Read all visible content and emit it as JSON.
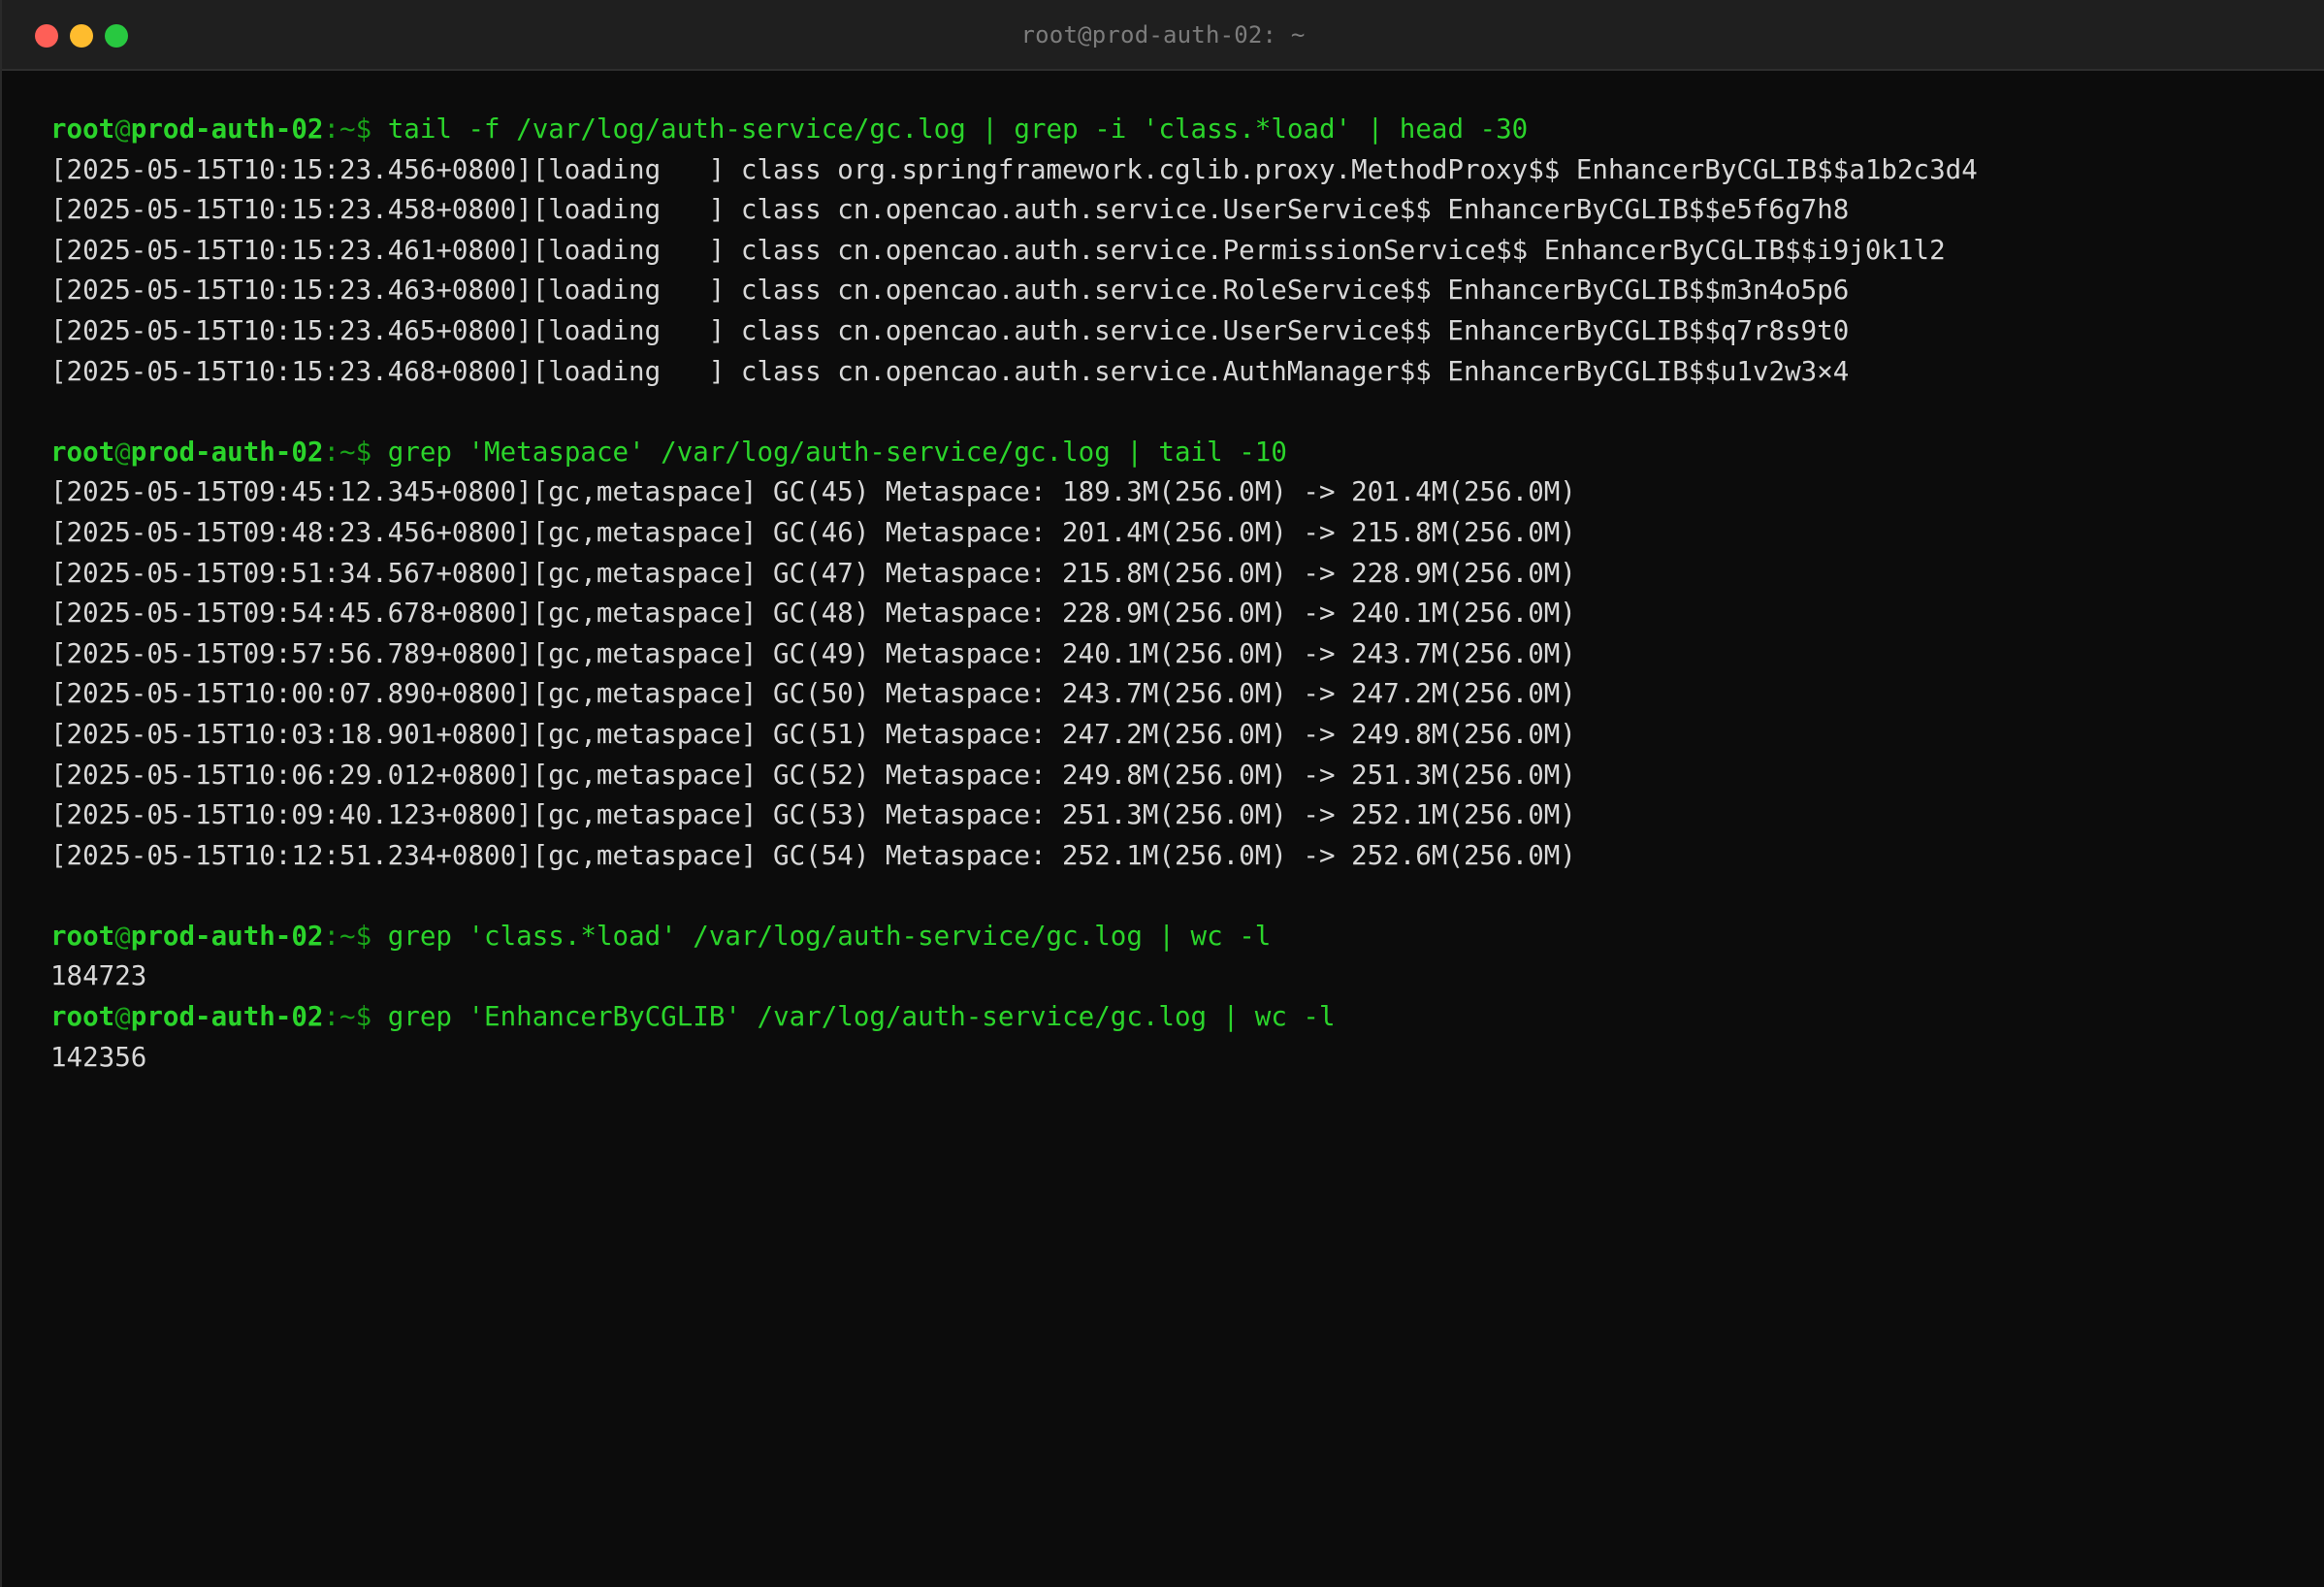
{
  "window": {
    "title": "root@prod-auth-02: ~"
  },
  "prompt": {
    "user": "root",
    "at": "@",
    "host": "prod-auth-02",
    "suffix": ":~$ "
  },
  "blocks": [
    {
      "command": "tail -f /var/log/auth-service/gc.log | grep -i 'class.*load' | head -30",
      "output": [
        "[2025-05-15T10:15:23.456+0800][loading   ] class org.springframework.cglib.proxy.MethodProxy$$ EnhancerByCGLIB$$a1b2c3d4",
        "[2025-05-15T10:15:23.458+0800][loading   ] class cn.opencao.auth.service.UserService$$ EnhancerByCGLIB$$e5f6g7h8",
        "[2025-05-15T10:15:23.461+0800][loading   ] class cn.opencao.auth.service.PermissionService$$ EnhancerByCGLIB$$i9j0k1l2",
        "[2025-05-15T10:15:23.463+0800][loading   ] class cn.opencao.auth.service.RoleService$$ EnhancerByCGLIB$$m3n4o5p6",
        "[2025-05-15T10:15:23.465+0800][loading   ] class cn.opencao.auth.service.UserService$$ EnhancerByCGLIB$$q7r8s9t0",
        "[2025-05-15T10:15:23.468+0800][loading   ] class cn.opencao.auth.service.AuthManager$$ EnhancerByCGLIB$$u1v2w3×4"
      ]
    },
    {
      "command": "grep 'Metaspace' /var/log/auth-service/gc.log | tail -10",
      "output": [
        "[2025-05-15T09:45:12.345+0800][gc,metaspace] GC(45) Metaspace: 189.3M(256.0M) -> 201.4M(256.0M)",
        "[2025-05-15T09:48:23.456+0800][gc,metaspace] GC(46) Metaspace: 201.4M(256.0M) -> 215.8M(256.0M)",
        "[2025-05-15T09:51:34.567+0800][gc,metaspace] GC(47) Metaspace: 215.8M(256.0M) -> 228.9M(256.0M)",
        "[2025-05-15T09:54:45.678+0800][gc,metaspace] GC(48) Metaspace: 228.9M(256.0M) -> 240.1M(256.0M)",
        "[2025-05-15T09:57:56.789+0800][gc,metaspace] GC(49) Metaspace: 240.1M(256.0M) -> 243.7M(256.0M)",
        "[2025-05-15T10:00:07.890+0800][gc,metaspace] GC(50) Metaspace: 243.7M(256.0M) -> 247.2M(256.0M)",
        "[2025-05-15T10:03:18.901+0800][gc,metaspace] GC(51) Metaspace: 247.2M(256.0M) -> 249.8M(256.0M)",
        "[2025-05-15T10:06:29.012+0800][gc,metaspace] GC(52) Metaspace: 249.8M(256.0M) -> 251.3M(256.0M)",
        "[2025-05-15T10:09:40.123+0800][gc,metaspace] GC(53) Metaspace: 251.3M(256.0M) -> 252.1M(256.0M)",
        "[2025-05-15T10:12:51.234+0800][gc,metaspace] GC(54) Metaspace: 252.1M(256.0M) -> 252.6M(256.0M)"
      ]
    },
    {
      "command": "grep 'class.*load' /var/log/auth-service/gc.log | wc -l",
      "output": [
        "184723"
      ]
    },
    {
      "command": "grep 'EnhancerByCGLIB' /var/log/auth-service/gc.log | wc -l",
      "output": [
        "142356"
      ]
    }
  ],
  "blank_after_block": [
    true,
    true,
    false,
    false
  ],
  "colors": {
    "background": "#0c0c0c",
    "titlebar": "#1f1f1f",
    "prompt_green": "#2bd42b",
    "output_text": "#d8d8d8",
    "close": "#fe5f57",
    "minimize": "#febc2e",
    "maximize": "#28c840"
  }
}
